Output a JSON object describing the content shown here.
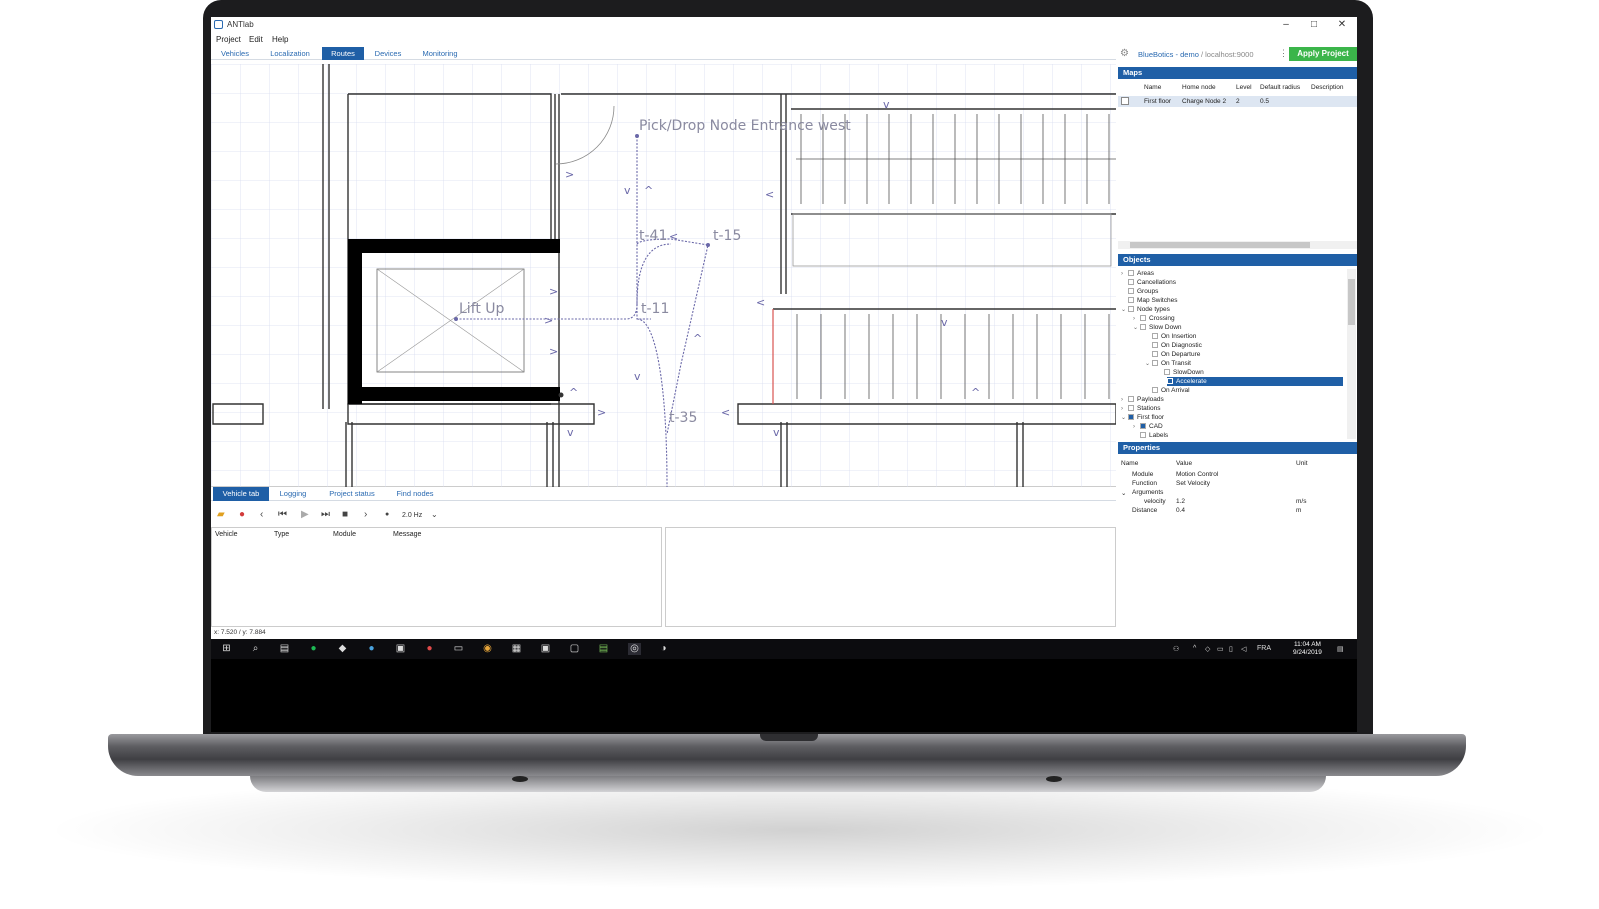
{
  "window": {
    "title": "ANTlab",
    "min": "–",
    "max": "□",
    "close": "✕"
  },
  "menu": {
    "project": "Project",
    "edit": "Edit",
    "help": "Help"
  },
  "tabs": [
    {
      "label": "Vehicles"
    },
    {
      "label": "Localization"
    },
    {
      "label": "Routes",
      "active": true
    },
    {
      "label": "Devices"
    },
    {
      "label": "Monitoring"
    }
  ],
  "server": {
    "name": "BlueBotics - demo",
    "host": " / localhost:9000"
  },
  "apply_label": "Apply Project",
  "map": {
    "labels": {
      "pick_drop": "Pick/Drop Node Entrance west",
      "t41": "t-41",
      "t15": "t-15",
      "t11": "t-11",
      "t35": "t-35",
      "lift": "Lift Up"
    }
  },
  "bottom_tabs": [
    {
      "label": "Vehicle tab",
      "active": true
    },
    {
      "label": "Logging"
    },
    {
      "label": "Project status"
    },
    {
      "label": "Find nodes"
    }
  ],
  "toolbar": {
    "frequency": "2.0 Hz"
  },
  "log_columns": [
    "Vehicle",
    "Type",
    "Module",
    "Message"
  ],
  "status_coords": "x: 7.520 / y: 7.884",
  "maps_panel": {
    "title": "Maps",
    "columns": [
      "Name",
      "Home node",
      "Level",
      "Default radius",
      "Description"
    ],
    "rows": [
      {
        "name": "First floor",
        "home": "Charge Node 2",
        "level": "2",
        "radius": "0.5",
        "desc": ""
      }
    ]
  },
  "objects_panel": {
    "title": "Objects",
    "items": [
      "Areas",
      "Cancellations",
      "Groups",
      "Map Switches",
      "Node types",
      "Crossing",
      "Slow Down",
      "On Insertion",
      "On Diagnostic",
      "On Departure",
      "On Transit",
      "SlowDown",
      "Accelerate",
      "On Arrival",
      "Payloads",
      "Stations",
      "First floor",
      "CAD",
      "Labels"
    ]
  },
  "properties_panel": {
    "title": "Properties",
    "columns": [
      "Name",
      "Value",
      "Unit"
    ],
    "rows": [
      {
        "name": "Module",
        "value": "Motion Control",
        "unit": ""
      },
      {
        "name": "Function",
        "value": "Set Velocity",
        "unit": ""
      },
      {
        "name": "Arguments",
        "value": "",
        "unit": ""
      },
      {
        "name": "velocity",
        "value": "1.2",
        "unit": "m/s"
      },
      {
        "name": "Distance",
        "value": "0.4",
        "unit": "m"
      }
    ]
  },
  "taskbar": {
    "lang": "FRA",
    "time": "11:04 AM",
    "date": "9/24/2019"
  }
}
